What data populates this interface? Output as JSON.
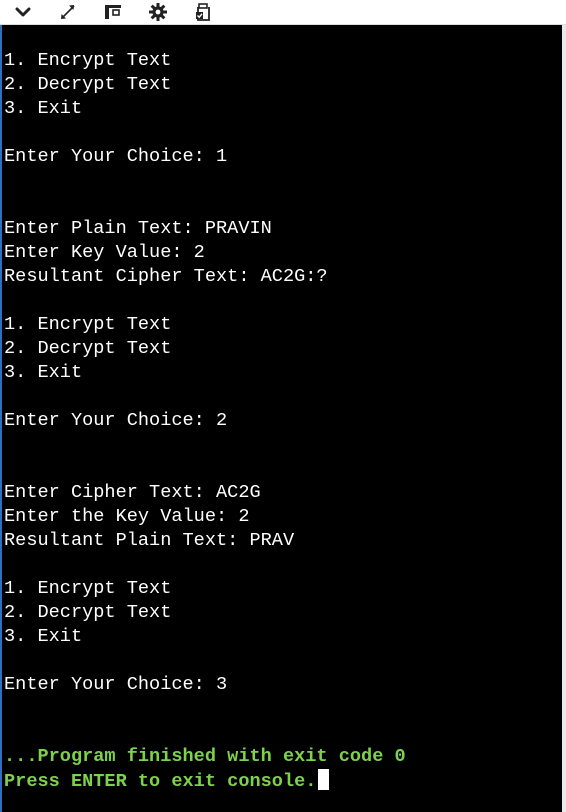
{
  "toolbar": {
    "buttons": [
      {
        "name": "collapse-button",
        "icon": "chevron-down-icon"
      },
      {
        "name": "expand-button",
        "icon": "expand-arrows-icon"
      },
      {
        "name": "layout-button",
        "icon": "layout-icon"
      },
      {
        "name": "settings-button",
        "icon": "gear-icon"
      },
      {
        "name": "copy-button",
        "icon": "clipboard-icon"
      }
    ]
  },
  "console": {
    "text_color": "#ffffff",
    "status_color": "#7cd14d",
    "lines": [
      {
        "text": "1. Encrypt Text",
        "kind": "output"
      },
      {
        "text": "2. Decrypt Text",
        "kind": "output"
      },
      {
        "text": "3. Exit",
        "kind": "output"
      },
      {
        "text": "",
        "kind": "output"
      },
      {
        "text": "Enter Your Choice: 1",
        "kind": "output"
      },
      {
        "text": "",
        "kind": "output"
      },
      {
        "text": "",
        "kind": "output"
      },
      {
        "text": "Enter Plain Text: PRAVIN",
        "kind": "output"
      },
      {
        "text": "Enter Key Value: 2",
        "kind": "output"
      },
      {
        "text": "Resultant Cipher Text: AC2G:?",
        "kind": "output"
      },
      {
        "text": "",
        "kind": "output"
      },
      {
        "text": "1. Encrypt Text",
        "kind": "output"
      },
      {
        "text": "2. Decrypt Text",
        "kind": "output"
      },
      {
        "text": "3. Exit",
        "kind": "output"
      },
      {
        "text": "",
        "kind": "output"
      },
      {
        "text": "Enter Your Choice: 2",
        "kind": "output"
      },
      {
        "text": "",
        "kind": "output"
      },
      {
        "text": "",
        "kind": "output"
      },
      {
        "text": "Enter Cipher Text: AC2G",
        "kind": "output"
      },
      {
        "text": "Enter the Key Value: 2",
        "kind": "output"
      },
      {
        "text": "Resultant Plain Text: PRAV",
        "kind": "output"
      },
      {
        "text": "",
        "kind": "output"
      },
      {
        "text": "1. Encrypt Text",
        "kind": "output"
      },
      {
        "text": "2. Decrypt Text",
        "kind": "output"
      },
      {
        "text": "3. Exit",
        "kind": "output"
      },
      {
        "text": "",
        "kind": "output"
      },
      {
        "text": "Enter Your Choice: 3",
        "kind": "output"
      },
      {
        "text": "",
        "kind": "output"
      },
      {
        "text": "",
        "kind": "output"
      },
      {
        "text": "...Program finished with exit code 0",
        "kind": "status"
      },
      {
        "text": "Press ENTER to exit console.",
        "kind": "status",
        "cursor": true
      }
    ]
  }
}
